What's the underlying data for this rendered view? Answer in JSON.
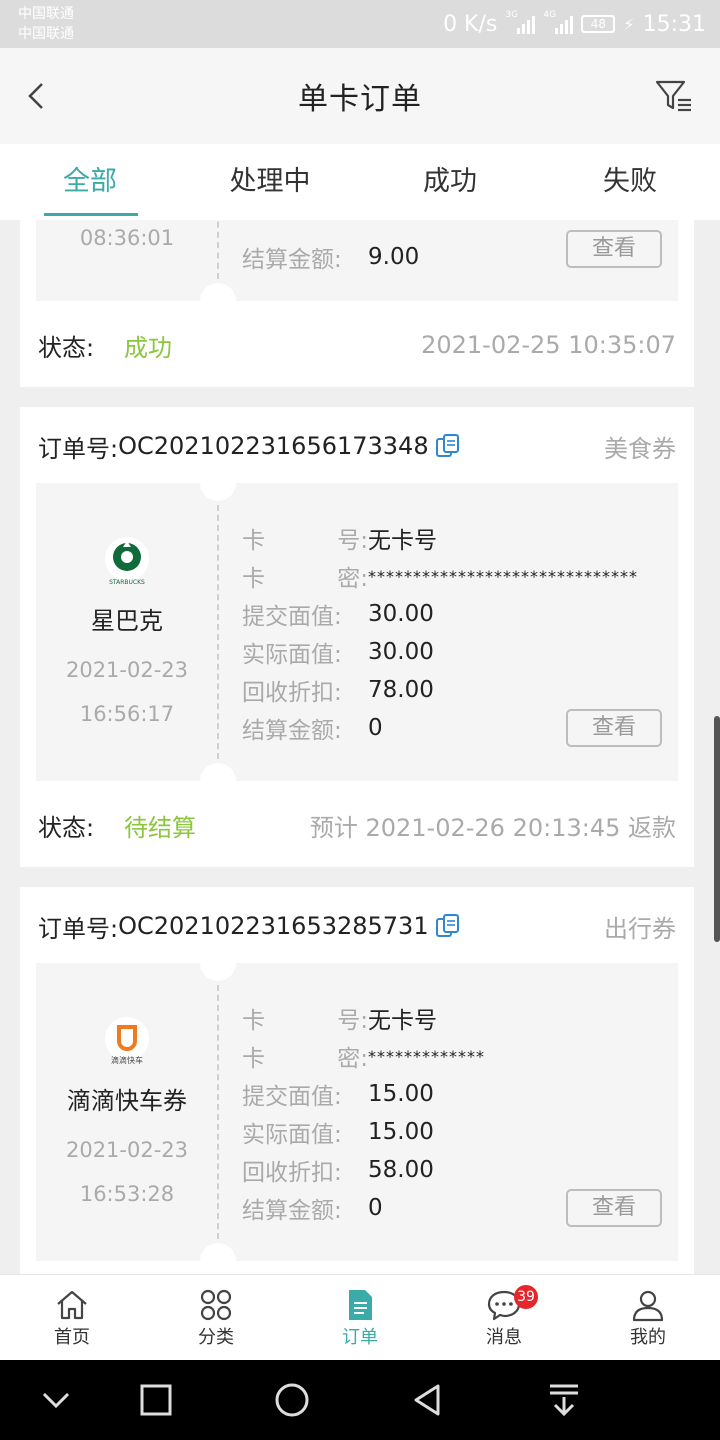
{
  "statusbar": {
    "carrier1": "中国联通",
    "carrier2": "中国联通",
    "speed": "0 K/s",
    "net1": "3G",
    "net2": "4G",
    "battery": "48",
    "time": "15:31"
  },
  "header": {
    "title": "单卡订单"
  },
  "tabs": [
    {
      "label": "全部",
      "active": true
    },
    {
      "label": "处理中",
      "active": false
    },
    {
      "label": "成功",
      "active": false
    },
    {
      "label": "失败",
      "active": false
    }
  ],
  "orders": [
    {
      "partial": true,
      "time": "08:36:01",
      "settle_label": "结算金额:",
      "settle": "9.00",
      "view_label": "查看",
      "status_label": "状态:",
      "status": "成功",
      "status_time": "2021-02-25 10:35:07"
    },
    {
      "order_label": "订单号:",
      "order_no": "OC202102231656173348",
      "category": "美食券",
      "brand": "星巴克",
      "logo_text": "STARBUCKS",
      "date": "2021-02-23",
      "time": "16:56:17",
      "fields": [
        {
          "k1": "卡",
          "k2": "号:",
          "v": "无卡号"
        },
        {
          "k1": "卡",
          "k2": "密:",
          "v": "******************************"
        },
        {
          "k1": "提交面值:",
          "k2": "",
          "v": "30.00"
        },
        {
          "k1": "实际面值:",
          "k2": "",
          "v": "30.00"
        },
        {
          "k1": "回收折扣:",
          "k2": "",
          "v": "78.00"
        },
        {
          "k1": "结算金额:",
          "k2": "",
          "v": "0"
        }
      ],
      "view_label": "查看",
      "status_label": "状态:",
      "status": "待结算",
      "status_time": "预计 2021-02-26 20:13:45 返款"
    },
    {
      "order_label": "订单号:",
      "order_no": "OC202102231653285731",
      "category": "出行券",
      "brand": "滴滴快车券",
      "logo_text": "滴滴快车",
      "date": "2021-02-23",
      "time": "16:53:28",
      "fields": [
        {
          "k1": "卡",
          "k2": "号:",
          "v": "无卡号"
        },
        {
          "k1": "卡",
          "k2": "密:",
          "v": "*************"
        },
        {
          "k1": "提交面值:",
          "k2": "",
          "v": "15.00"
        },
        {
          "k1": "实际面值:",
          "k2": "",
          "v": "15.00"
        },
        {
          "k1": "回收折扣:",
          "k2": "",
          "v": "58.00"
        },
        {
          "k1": "结算金额:",
          "k2": "",
          "v": "0"
        }
      ],
      "view_label": "查看"
    }
  ],
  "bottom_nav": [
    {
      "label": "首页",
      "icon": "home-icon"
    },
    {
      "label": "分类",
      "icon": "category-icon"
    },
    {
      "label": "订单",
      "icon": "order-icon",
      "active": true
    },
    {
      "label": "消息",
      "icon": "message-icon",
      "badge": "39"
    },
    {
      "label": "我的",
      "icon": "profile-icon"
    }
  ],
  "colors": {
    "accent": "#3aaba8",
    "success": "#8cc63f",
    "badge": "#e5262a"
  }
}
